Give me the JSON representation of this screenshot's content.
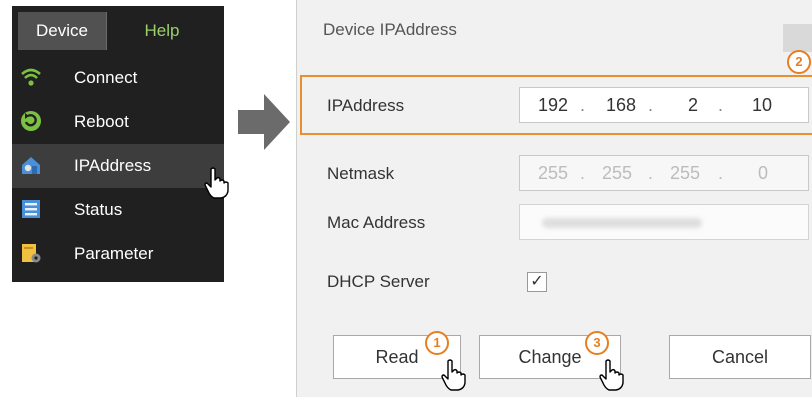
{
  "menu": {
    "bar": {
      "device": "Device",
      "help": "Help"
    },
    "items": [
      {
        "label": "Connect",
        "icon": "wifi-icon"
      },
      {
        "label": "Reboot",
        "icon": "refresh-icon"
      },
      {
        "label": "IPAddress",
        "icon": "home-network-icon"
      },
      {
        "label": "Status",
        "icon": "status-list-icon"
      },
      {
        "label": "Parameter",
        "icon": "parameter-icon"
      }
    ]
  },
  "dialog": {
    "title": "Device IPAddress",
    "fields": {
      "ip_label": "IPAddress",
      "ip": [
        "192",
        "168",
        "2",
        "10"
      ],
      "netmask_label": "Netmask",
      "netmask": [
        "255",
        "255",
        "255",
        "0"
      ],
      "mac_label": "Mac Address",
      "dhcp_label": "DHCP Server",
      "dhcp_checked": "✓"
    },
    "buttons": {
      "read": "Read",
      "change": "Change",
      "cancel": "Cancel"
    },
    "badges": [
      "1",
      "2",
      "3"
    ]
  },
  "colors": {
    "accent": "#e8902f",
    "menu_bg": "#202020",
    "help": "#9bd06c"
  }
}
